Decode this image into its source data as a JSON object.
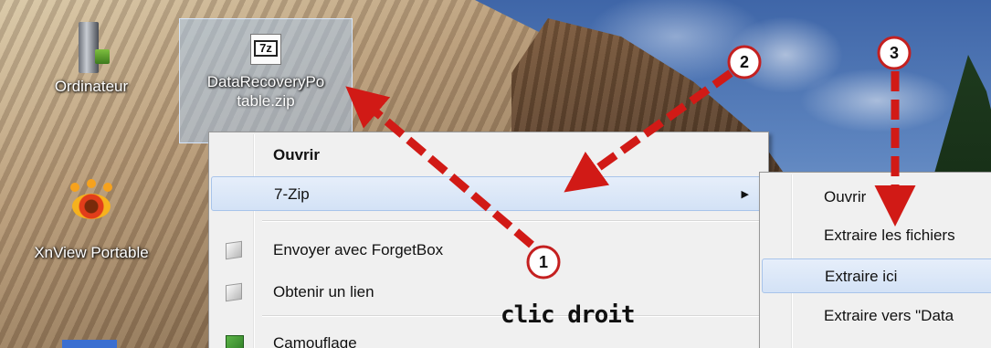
{
  "desktop": {
    "icons": [
      {
        "label": "Ordinateur"
      },
      {
        "label_line1": "DataRecoveryPo",
        "label_line2": "table.zip"
      },
      {
        "label": "XnView Portable"
      }
    ],
    "zip_icon_text": "7z"
  },
  "context_menu": {
    "items": [
      {
        "label": "Ouvrir"
      },
      {
        "label": "7-Zip"
      },
      {
        "label": "Envoyer avec ForgetBox"
      },
      {
        "label": "Obtenir un lien"
      },
      {
        "label": "Camouflage"
      }
    ],
    "submenu_arrow": "▶"
  },
  "submenu_7zip": {
    "items": [
      {
        "label": "Ouvrir"
      },
      {
        "label": "Extraire les fichiers"
      },
      {
        "label": "Extraire ici"
      },
      {
        "label": "Extraire vers \"Data"
      }
    ]
  },
  "annotations": {
    "steps": [
      "1",
      "2",
      "3"
    ],
    "caption": "clic droit",
    "arrow_color": "#d11a16"
  }
}
